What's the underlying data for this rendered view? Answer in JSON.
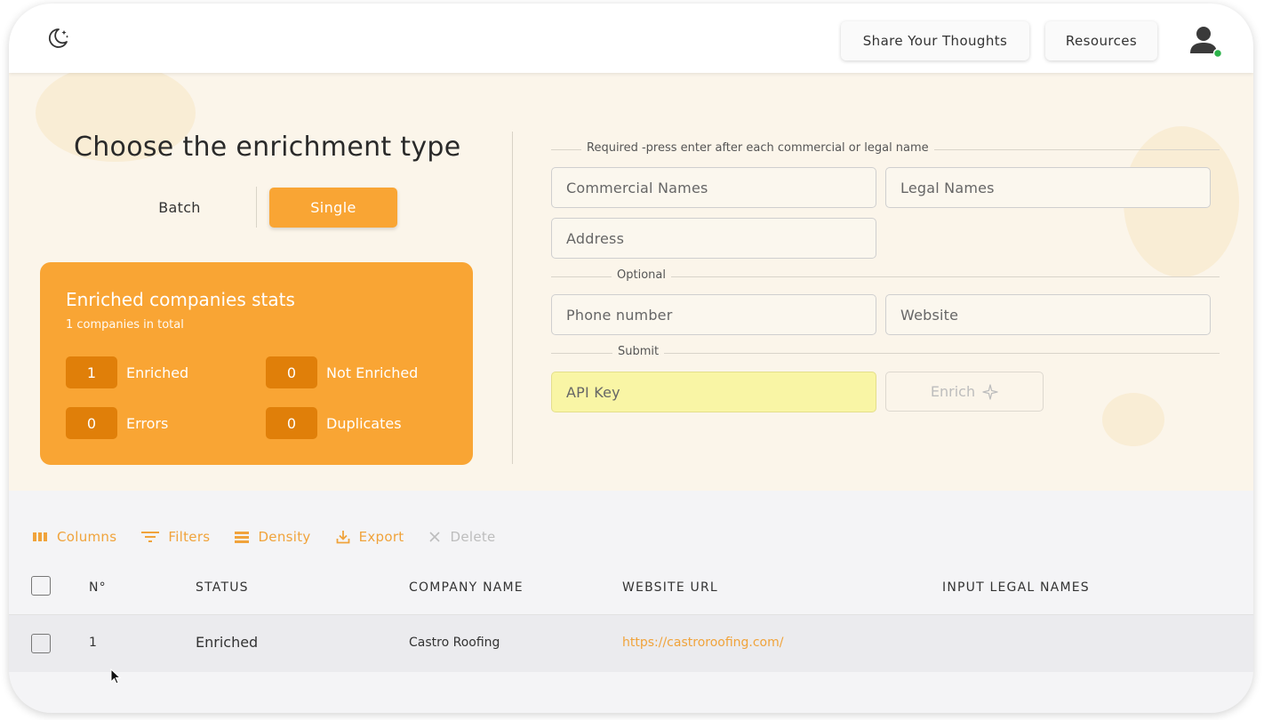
{
  "header": {
    "theme_icon": "moon-stars-icon",
    "share_label": "Share Your Thoughts",
    "resources_label": "Resources",
    "avatar_icon": "user-icon",
    "status_color": "#2cb34a"
  },
  "enrichment": {
    "title": "Choose the enrichment type",
    "batch_label": "Batch",
    "single_label": "Single",
    "selected": "Single"
  },
  "stats": {
    "title": "Enriched companies stats",
    "subtitle": "1 companies in total",
    "enriched_value": "1",
    "enriched_label": "Enriched",
    "not_enriched_value": "0",
    "not_enriched_label": "Not Enriched",
    "errors_value": "0",
    "errors_label": "Errors",
    "duplicates_value": "0",
    "duplicates_label": "Duplicates"
  },
  "form": {
    "required_label": "Required -press enter after each commercial or legal name",
    "commercial_placeholder": "Commercial Names",
    "legal_placeholder": "Legal Names",
    "address_placeholder": "Address",
    "optional_label": "Optional",
    "phone_placeholder": "Phone number",
    "website_placeholder": "Website",
    "submit_label": "Submit",
    "api_key_placeholder": "API Key",
    "enrich_label": "Enrich"
  },
  "toolbar": {
    "columns": "Columns",
    "filters": "Filters",
    "density": "Density",
    "export": "Export",
    "delete": "Delete"
  },
  "table": {
    "headers": [
      "N°",
      "STATUS",
      "COMPANY NAME",
      "WEBSITE URL",
      "INPUT LEGAL NAMES"
    ],
    "rows": [
      {
        "number": "1",
        "status": "Enriched",
        "company_name": "Castro Roofing",
        "website_url": "https://castroroofing.com/",
        "input_legal_names": ""
      }
    ]
  },
  "colors": {
    "accent": "#f9a534",
    "accent_dark": "#e07f09",
    "link": "#f0a33b",
    "api_highlight": "#f9f5a5"
  }
}
